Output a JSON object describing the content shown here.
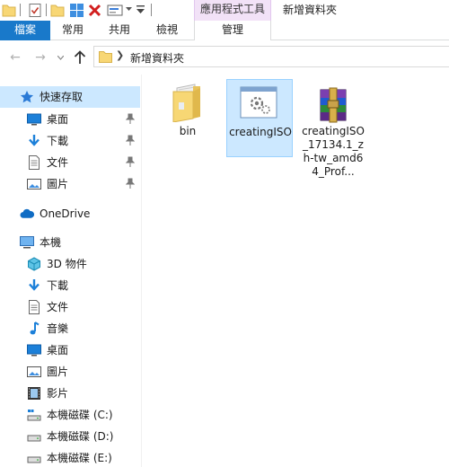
{
  "window": {
    "title": "新增資料夾",
    "context_group": "應用程式工具"
  },
  "ribbon": {
    "tabs": [
      {
        "label": "檔案"
      },
      {
        "label": "常用"
      },
      {
        "label": "共用"
      },
      {
        "label": "檢視"
      },
      {
        "label": "管理"
      }
    ]
  },
  "address": {
    "path": "新增資料夾"
  },
  "navigation": {
    "quick_access": "快速存取",
    "pinned": [
      {
        "label": "桌面",
        "icon": "desktop-icon"
      },
      {
        "label": "下載",
        "icon": "download-icon"
      },
      {
        "label": "文件",
        "icon": "document-icon"
      },
      {
        "label": "圖片",
        "icon": "picture-icon"
      }
    ],
    "onedrive": "OneDrive",
    "this_pc": "本機",
    "pc_items": [
      {
        "label": "3D 物件",
        "icon": "3d-objects-icon"
      },
      {
        "label": "下載",
        "icon": "download-icon"
      },
      {
        "label": "文件",
        "icon": "document-icon"
      },
      {
        "label": "音樂",
        "icon": "music-icon"
      },
      {
        "label": "桌面",
        "icon": "desktop-icon"
      },
      {
        "label": "圖片",
        "icon": "picture-icon"
      },
      {
        "label": "影片",
        "icon": "video-icon"
      },
      {
        "label": "本機磁碟 (C:)",
        "icon": "system-drive-icon"
      },
      {
        "label": "本機磁碟 (D:)",
        "icon": "drive-icon"
      },
      {
        "label": "本機磁碟 (E:)",
        "icon": "drive-icon"
      }
    ]
  },
  "files": [
    {
      "name": "bin",
      "icon": "folder-icon",
      "selected": false
    },
    {
      "name": "creatingISO",
      "icon": "application-icon",
      "selected": true
    },
    {
      "name": "creatingISO_17134.1_zh-tw_amd64_Prof...",
      "icon": "winrar-archive-icon",
      "selected": false
    }
  ]
}
